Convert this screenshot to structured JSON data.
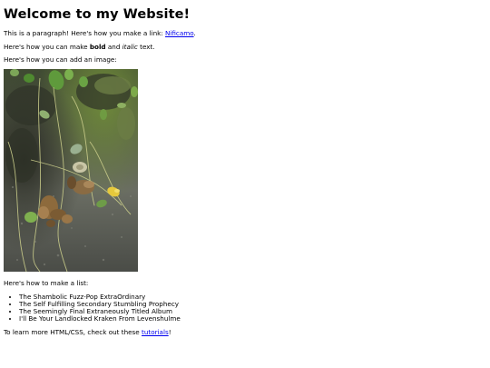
{
  "heading": "Welcome to my Website!",
  "para_link": {
    "before": "This is a paragraph! Here's how you make a link: ",
    "link_text": "Nificamo",
    "after": "."
  },
  "para_format": {
    "before": "Here's how you can make ",
    "bold": "bold",
    "middle": " and ",
    "italic": "italic",
    "after": " text."
  },
  "para_image": "Here's how you can add an image:",
  "image": {
    "subject": "rocky ground with leaves, vines and small yellow flower"
  },
  "para_list": "Here's how to make a list:",
  "list_items": [
    "The Shambolic Fuzz-Pop ExtraOrdinary",
    "The Self Fulfilling Secondary Stumbling Prophecy",
    "The Seemingly Final Extraneously Titled Album",
    "I'll Be Your Landlocked Kraken From Levenshulme"
  ],
  "para_tutorials": {
    "before": "To learn more HTML/CSS, check out these ",
    "link_text": "tutorials",
    "after": "!"
  },
  "colors": {
    "link": "#0000ee",
    "text": "#000000",
    "background": "#ffffff"
  }
}
